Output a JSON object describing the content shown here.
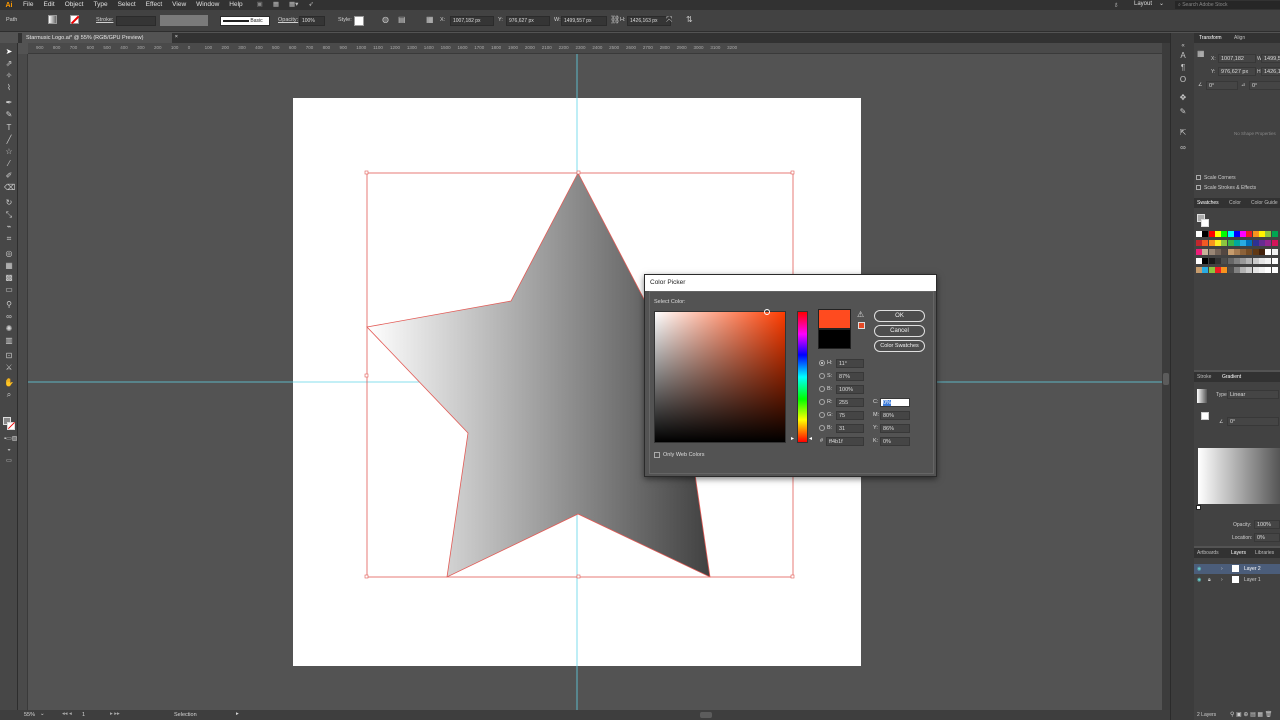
{
  "app": {
    "logo": "Ai"
  },
  "menubar": {
    "items": [
      "File",
      "Edit",
      "Object",
      "Type",
      "Select",
      "Effect",
      "View",
      "Window",
      "Help"
    ],
    "workspace": "Layout",
    "search_placeholder": "Search Adobe Stock"
  },
  "controlbar": {
    "object_type": "Path",
    "stroke_label": "Stroke:",
    "brush_label": "Basic",
    "opacity_label": "Opacity:",
    "opacity_value": "100%",
    "style_label": "Style:",
    "x_label": "X:",
    "x_value": "1007,182 px",
    "y_label": "Y:",
    "y_value": "976,627 px",
    "w_label": "W:",
    "w_value": "1499,557 px",
    "h_label": "H:",
    "h_value": "1426,163 px"
  },
  "document": {
    "tab_title": "Starmusic Logo.ai* @ 55% (RGB/GPU Preview)",
    "close": "×"
  },
  "ruler": {
    "ticks": [
      "900",
      "800",
      "700",
      "600",
      "500",
      "400",
      "300",
      "200",
      "100",
      "0",
      "100",
      "200",
      "300",
      "400",
      "500",
      "600",
      "700",
      "800",
      "900",
      "1000",
      "1100",
      "1200",
      "1300",
      "1400",
      "1500",
      "1600",
      "1700",
      "1800",
      "1900",
      "2000",
      "2100",
      "2200",
      "2300",
      "2400",
      "2500",
      "2600",
      "2700",
      "2800",
      "2900",
      "3000",
      "3100",
      "3200"
    ]
  },
  "colorpicker": {
    "title": "Color Picker",
    "select_color_label": "Select Color:",
    "h_label": "H:",
    "h_value": "11°",
    "s_label": "S:",
    "s_value": "87%",
    "b_label": "B:",
    "b_value": "100%",
    "r_label": "R:",
    "r_value": "255",
    "g_label": "G:",
    "g_value": "75",
    "bl_label": "B:",
    "bl_value": "31",
    "hex_label": "#",
    "hex_value": "ff4b1f",
    "c_label": "C:",
    "c_value": "0%",
    "m_label": "M:",
    "m_value": "80%",
    "y_label": "Y:",
    "y_value": "86%",
    "k_label": "K:",
    "k_value": "0%",
    "ok_label": "OK",
    "cancel_label": "Cancel",
    "swatches_label": "Color Swatches",
    "web_colors_label": "Only Web Colors",
    "new_color": "#ff4b1f",
    "old_color": "#000000"
  },
  "transform_panel": {
    "tabs": [
      "Transform",
      "Align"
    ],
    "x_label": "X:",
    "x_value": "1007,182",
    "y_label": "Y:",
    "y_value": "976,627 px",
    "w_label": "W:",
    "w_value": "1499,55",
    "h_label": "H:",
    "h_value": "1426,16",
    "angle_value": "0°",
    "shear_value": "0°",
    "no_shape": "No Shape Properties",
    "scale_corners": "Scale Corners",
    "scale_strokes": "Scale Strokes & Effects"
  },
  "swatches_panel": {
    "tabs": [
      "Swatches",
      "Color",
      "Color Guide"
    ]
  },
  "gradient_panel": {
    "tabs": [
      "Stroke",
      "Gradient"
    ],
    "type_label": "Type:",
    "type_value": "Linear",
    "angle_value": "0°",
    "opacity_label": "Opacity:",
    "opacity_value": "100%",
    "location_label": "Location:",
    "location_value": "0%"
  },
  "layers_panel": {
    "tabs": [
      "Artboards",
      "Layers",
      "Libraries"
    ],
    "layers": [
      "Layer 2",
      "Layer 1"
    ],
    "count": "2 Layers"
  },
  "statusbar": {
    "zoom": "55%",
    "artboard": "1",
    "tool": "Selection"
  }
}
